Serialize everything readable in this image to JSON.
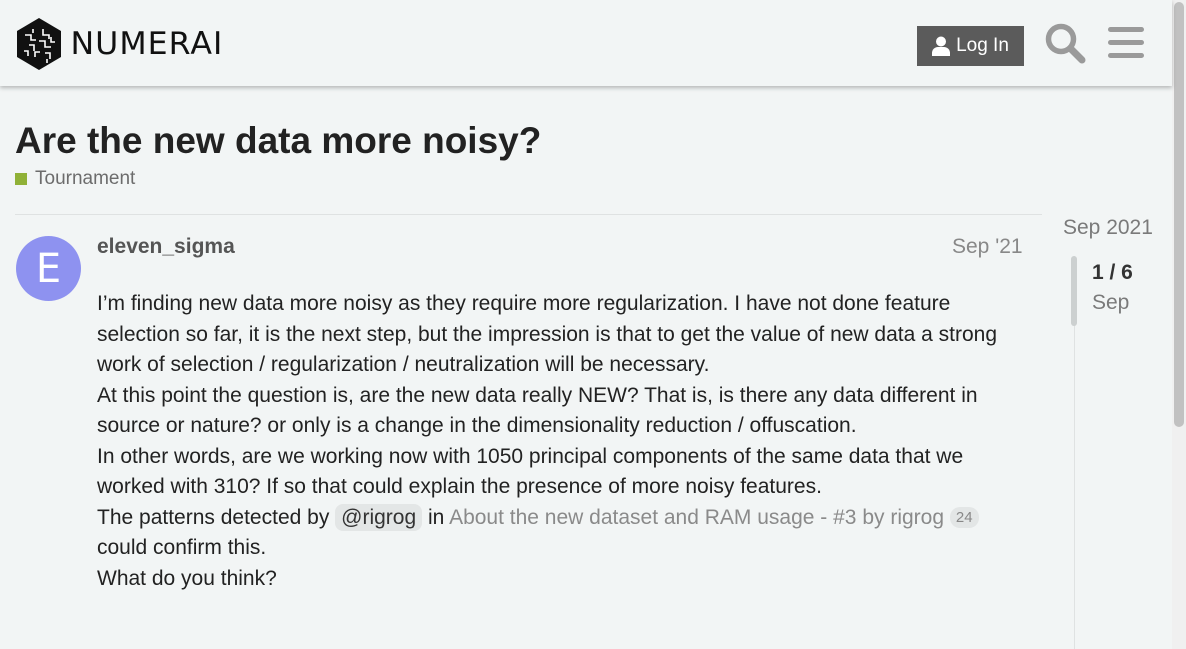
{
  "header": {
    "logo_text": "NUMERAI",
    "login_label": "Log In",
    "search_icon": "search-icon",
    "menu_icon": "hamburger-menu-icon"
  },
  "topic": {
    "title": "Are the new data more noisy?",
    "category": {
      "label": "Tournament",
      "color": "#90b137"
    }
  },
  "post": {
    "avatar_letter": "E",
    "avatar_color": "#8e92f0",
    "username": "eleven_sigma",
    "date": "Sep '21",
    "paragraphs": [
      "I’m finding new data more noisy as they require more regularization. I have not done feature selection so far, it is the next step, but the impression is that to get the value of new data a strong work of selection / regularization / neutralization will be necessary.",
      "At this point the question is, are the new data really NEW? That is, is there any data different in source or nature? or only is a change in the dimensionality reduction / offuscation.",
      "In other words, are we working now with 1050 principal components of the same data that we worked with 310? If so that could explain the presence of more noisy features."
    ],
    "pattern_line": {
      "prefix": "The patterns detected by",
      "mention": "@rigrog",
      "in_word": "in",
      "link_text": "About the new dataset and RAM usage - #3 by rigrog",
      "click_count": "24",
      "suffix": "could confirm this."
    },
    "closing": "What do you think?"
  },
  "timeline": {
    "top_date": "Sep 2021",
    "position": "1 / 6",
    "sub_date": "Sep"
  }
}
